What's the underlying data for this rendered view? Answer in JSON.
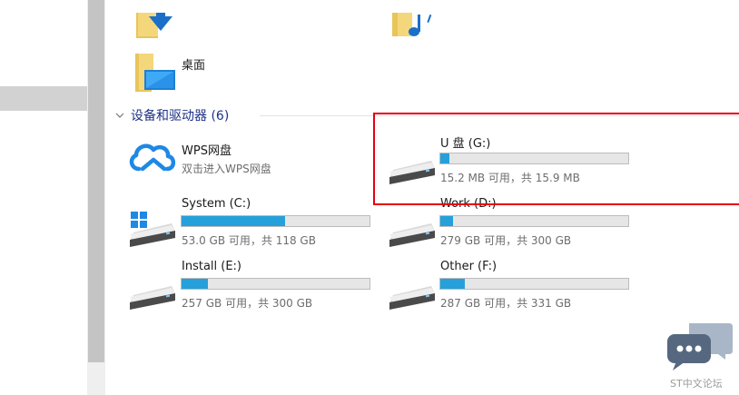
{
  "quick_access": {
    "desktop_label": "桌面"
  },
  "devices_group": {
    "title": "设备和驱动器 (6)"
  },
  "wps_drive": {
    "name": "WPS网盘",
    "subtitle": "双击进入WPS网盘"
  },
  "drives": [
    {
      "name": "U 盘 (G:)",
      "space": "15.2 MB 可用，共 15.9 MB",
      "used_fraction": 0.05
    },
    {
      "name": "System (C:)",
      "space": "53.0 GB 可用，共 118 GB",
      "used_fraction": 0.55
    },
    {
      "name": "Work (D:)",
      "space": "279 GB 可用，共 300 GB",
      "used_fraction": 0.07
    },
    {
      "name": "Install (E:)",
      "space": "257 GB 可用，共 300 GB",
      "used_fraction": 0.14
    },
    {
      "name": "Other (F:)",
      "space": "287 GB 可用，共 331 GB",
      "used_fraction": 0.13
    }
  ],
  "watermark": {
    "text": "ST中文论坛"
  },
  "colors": {
    "accent": "#26a0da",
    "highlight": "#e60012",
    "group_title": "#1e3287"
  }
}
